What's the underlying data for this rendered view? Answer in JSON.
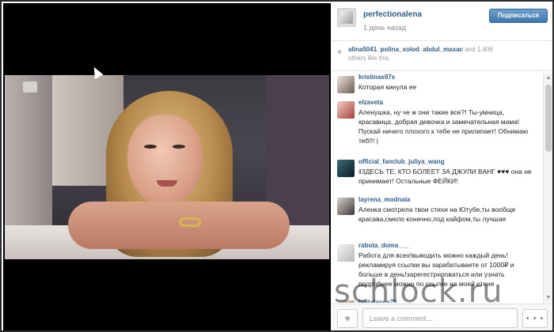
{
  "post": {
    "username": "perfectionalena",
    "time": "1 день назад",
    "follow_label": "Подписаться"
  },
  "likes": {
    "users": [
      "alina5041",
      "polina_xolod",
      "abdul_maxac"
    ],
    "and_text": "and",
    "count": "1,406",
    "others_text": "others like this."
  },
  "comments": [
    {
      "user": "kristinas97s",
      "text": "Которая кинула ее"
    },
    {
      "user": "elzaveta",
      "text": "Аленушка, ну че ж они такие все?! Ты-умница, красавица, добрая девочка и замечательная мама! Пускай ничего плохого к тебе не прилипает! Обнимаю теб!!! |"
    },
    {
      "user": "official_fanclub_juliya_wang",
      "text": "ǁЗДЕСЬ ТЕ, КТО БОЛЕЕТ ЗА ДЖУЛИ ВАНГ ♥♥♥ она не принимает! Остальные ФЕЙКИ!"
    },
    {
      "user": "layrena_modnaia",
      "text": "Аленка смотрела твои стихи на Ютубе,ты вообще красава,смело конечно,под кайфом,ты лучшая"
    },
    {
      "user": "rabota_doma___",
      "text": "Работа для всех!выводить можно каждый день! рекламируя ссылки вы зарабатываете от 1000₽ и больше в день!зарегестрироваться или узнать подробнее можно по ссылке на моей стене"
    },
    {
      "user": "badabiova75",
      "text": ""
    }
  ],
  "footer": {
    "comment_placeholder": "Leave a comment...",
    "more_label": "• • •"
  },
  "icons": {
    "heart": "heart-icon",
    "more": "more-icon"
  },
  "watermark": "schlock.ru",
  "colors": {
    "username": "#2f5d8a",
    "follow_button": "#3e78ae"
  }
}
